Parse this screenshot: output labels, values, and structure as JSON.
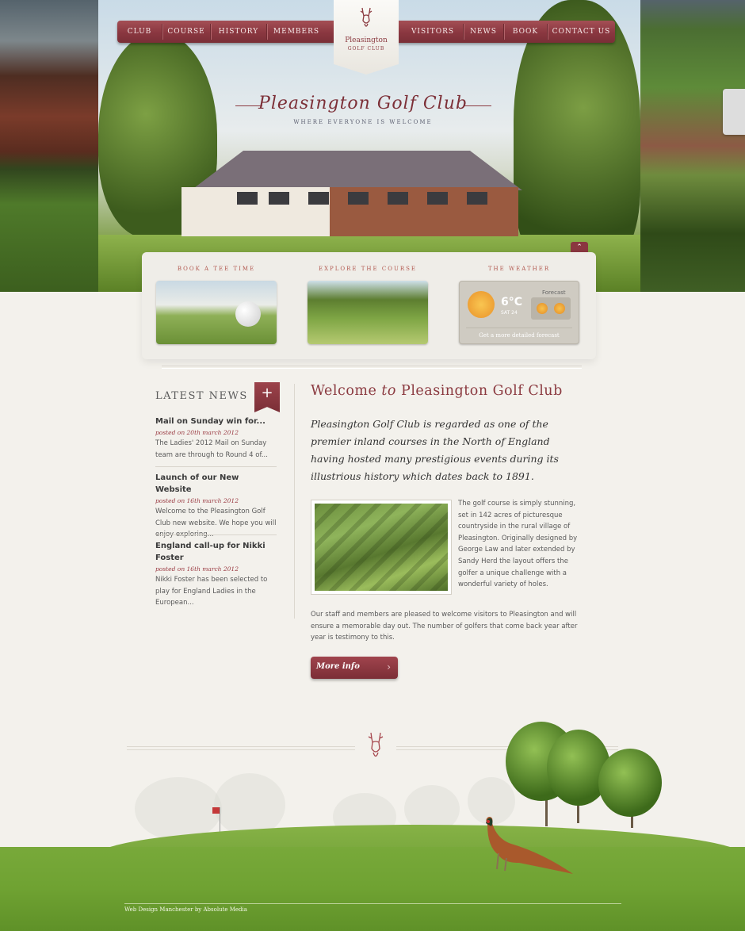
{
  "nav": {
    "items": [
      "CLUB",
      "COURSE",
      "HISTORY",
      "MEMBERS",
      "VISITORS",
      "NEWS",
      "BOOK",
      "CONTACT US"
    ]
  },
  "logo": {
    "name": "Pleasington",
    "sub": "GOLF CLUB",
    "icon": "stag-icon"
  },
  "hero": {
    "title": "Pleasington Golf Club",
    "tagline": "WHERE EVERYONE IS WELCOME"
  },
  "panel": {
    "tee_label": "BOOK A TEE TIME",
    "course_label": "EXPLORE THE COURSE",
    "weather_label": "THE WEATHER",
    "weather": {
      "temp": "6°C",
      "day": "SAT 24",
      "forecast_label": "Forecast",
      "link": "Get a more detailed forecast"
    }
  },
  "news": {
    "heading": "LATEST NEWS",
    "add_icon": "+",
    "items": [
      {
        "title": "Mail on Sunday win for...",
        "date": "posted on 20th march 2012",
        "text": "The Ladies' 2012 Mail on Sunday team are through to Round 4 of..."
      },
      {
        "title": "Launch of our New Website",
        "date": "posted on 16th march 2012",
        "text": "Welcome to the Pleasington Golf Club new website. We hope you will enjoy exploring..."
      },
      {
        "title": "England call-up for Nikki Foster",
        "date": "posted on 16th march 2012",
        "text": "Nikki Foster has been selected to play for England Ladies in the European..."
      }
    ]
  },
  "welcome": {
    "pre": "Welcome",
    "to": "to",
    "post": "Pleasington Golf Club",
    "lead": "Pleasington Golf Club is regarded as one of the premier inland courses in the North of England having hosted many prestigious events during its illustrious history which dates back to 1891.",
    "para1": "The golf course is simply stunning, set in 142 acres of picturesque countryside in the rural village of Pleasington. Originally designed by George Law and later extended by Sandy Herd the layout offers the golfer a unique challenge with a wonderful variety of holes.",
    "para2": "Our staff and members are pleased to welcome visitors to Pleasington and will ensure a memorable day out. The number of golfers that come back year after year is testimony to this.",
    "button": "More info",
    "button_arrow": "›"
  },
  "footer": {
    "credit": "Web Design Manchester by Absolute Media"
  },
  "colors": {
    "accent": "#8b3a40",
    "nav": "#8a3740",
    "grass": "#6fa232"
  }
}
